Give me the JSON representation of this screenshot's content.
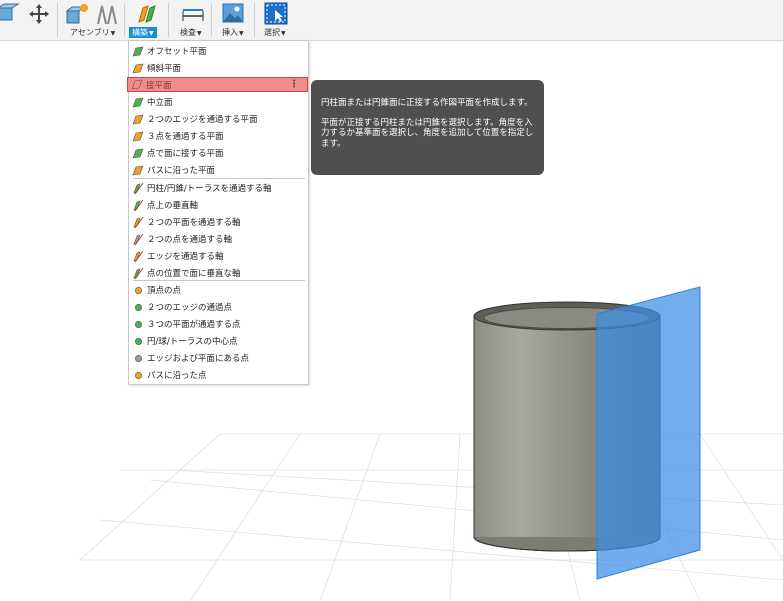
{
  "toolbar": {
    "assembly_label": "アセンブリ",
    "construct_label": "構築",
    "inspect_label": "検査",
    "insert_label": "挿入",
    "select_label": "選択"
  },
  "menu": {
    "items": [
      {
        "label": "オフセット平面",
        "icon": "offset-plane-icon"
      },
      {
        "label": "傾斜平面",
        "icon": "plane-at-angle-icon"
      },
      {
        "label": "接平面",
        "icon": "tangent-plane-icon"
      },
      {
        "label": "中立面",
        "icon": "midplane-icon"
      },
      {
        "label": "２つのエッジを通過する平面",
        "icon": "plane-through-two-edges-icon"
      },
      {
        "label": "３点を通過する平面",
        "icon": "plane-through-three-points-icon"
      },
      {
        "label": "点で面に接する平面",
        "icon": "plane-tangent-at-point-icon"
      },
      {
        "label": "パスに沿った平面",
        "icon": "plane-along-path-icon"
      },
      {
        "label": "円柱/円錐/トーラスを通過する軸",
        "icon": "axis-through-cylinder-icon"
      },
      {
        "label": "点上の垂直軸",
        "icon": "axis-perpendicular-at-point-icon"
      },
      {
        "label": "２つの平面を通過する軸",
        "icon": "axis-through-two-planes-icon"
      },
      {
        "label": "２つの点を通過する軸",
        "icon": "axis-through-two-points-icon"
      },
      {
        "label": "エッジを通過する軸",
        "icon": "axis-through-edge-icon"
      },
      {
        "label": "点の位置で面に垂直な軸",
        "icon": "axis-perpendicular-to-face-icon"
      },
      {
        "label": "頂点の点",
        "icon": "point-at-vertex-icon"
      },
      {
        "label": "２つのエッジの通過点",
        "icon": "point-through-two-edges-icon"
      },
      {
        "label": "３つの平面が通過する点",
        "icon": "point-through-three-planes-icon"
      },
      {
        "label": "円/球/トーラスの中心点",
        "icon": "point-at-center-icon"
      },
      {
        "label": "エッジおよび平面にある点",
        "icon": "point-at-edge-and-plane-icon"
      },
      {
        "label": "パスに沿った点",
        "icon": "point-along-path-icon"
      }
    ],
    "more_glyph": "⋮"
  },
  "tooltip": {
    "title": "円柱面または円錐面に正接する作図平面を作成します。",
    "body": "平面が正接する円柱または円錐を選択します。角度を入力するか基準面を選択し、角度を追加して位置を指定します。"
  },
  "colors": {
    "accent": "#1a8fd8",
    "highlight": "#f08c8c",
    "tooltip_bg": "#4f4f4f",
    "plane": "#3b8fe8"
  }
}
